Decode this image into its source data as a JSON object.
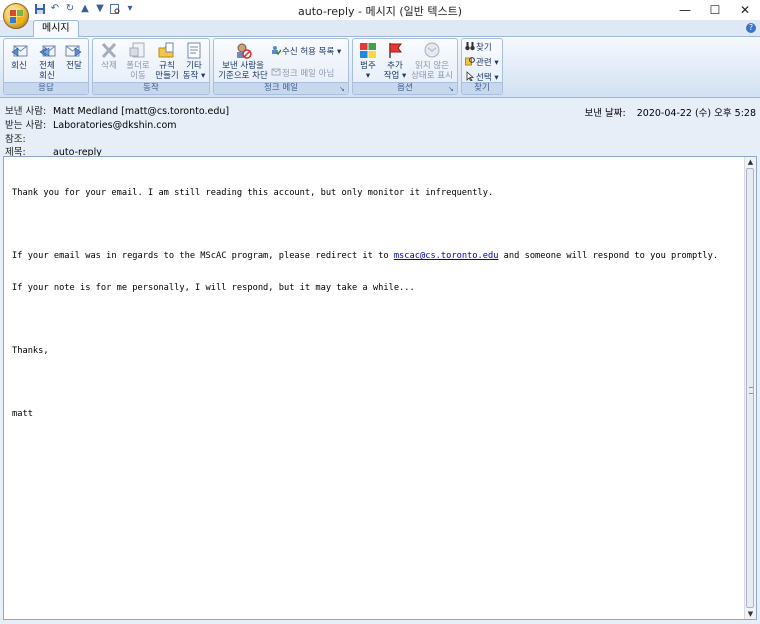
{
  "window": {
    "title": "auto-reply - 메시지 (일반 텍스트)",
    "minimize": "—",
    "maximize": "☐",
    "close": "✕"
  },
  "tabs": [
    {
      "label": "메시지"
    }
  ],
  "ribbon": {
    "respond": {
      "label": "응답",
      "reply": "회신",
      "reply_all_1": "전체",
      "reply_all_2": "회신",
      "forward": "전달"
    },
    "actions": {
      "label": "동작",
      "delete": "삭제",
      "move_1": "폴더로",
      "move_2": "이동",
      "rules_1": "규칙",
      "rules_2": "만들기",
      "other_1": "기타",
      "other_2": "동작"
    },
    "junk": {
      "label": "정크 메일",
      "block_1": "보낸 사람을",
      "block_2": "기준으로 차단",
      "safe_list": "수신 허용 목록",
      "not_junk": "정크 메일 아님"
    },
    "options": {
      "label": "옵션",
      "categorize_1": "범주",
      "follow_up_1": "추가",
      "follow_up_2": "작업",
      "mark_unread_1": "읽지 않은",
      "mark_unread_2": "상태로 표시"
    },
    "find": {
      "label": "찾기",
      "find": "찾기",
      "related": "관련",
      "select": "선택"
    }
  },
  "message": {
    "from_label": "보낸 사람:",
    "from": "Matt Medland [matt@cs.toronto.edu]",
    "to_label": "받는 사람:",
    "to": "Laboratories@dkshin.com",
    "cc_label": "참조:",
    "cc": "",
    "subject_label": "제목:",
    "subject": "auto-reply",
    "sent_label": "보낸 날짜:",
    "sent": "2020-04-22 (수) 오후 5:28"
  },
  "body": {
    "line1": "Thank you for your email. I am still reading this account, but only monitor it infrequently.",
    "line2_pre": "If your email was in regards to the MScAC program, please redirect it to ",
    "line2_link": "mscac@cs.toronto.edu",
    "line2_post": " and someone will respond to you promptly.",
    "line3": "If your note is for me personally, I will respond, but it may take a while...",
    "line4": "Thanks,",
    "line5": "matt"
  }
}
